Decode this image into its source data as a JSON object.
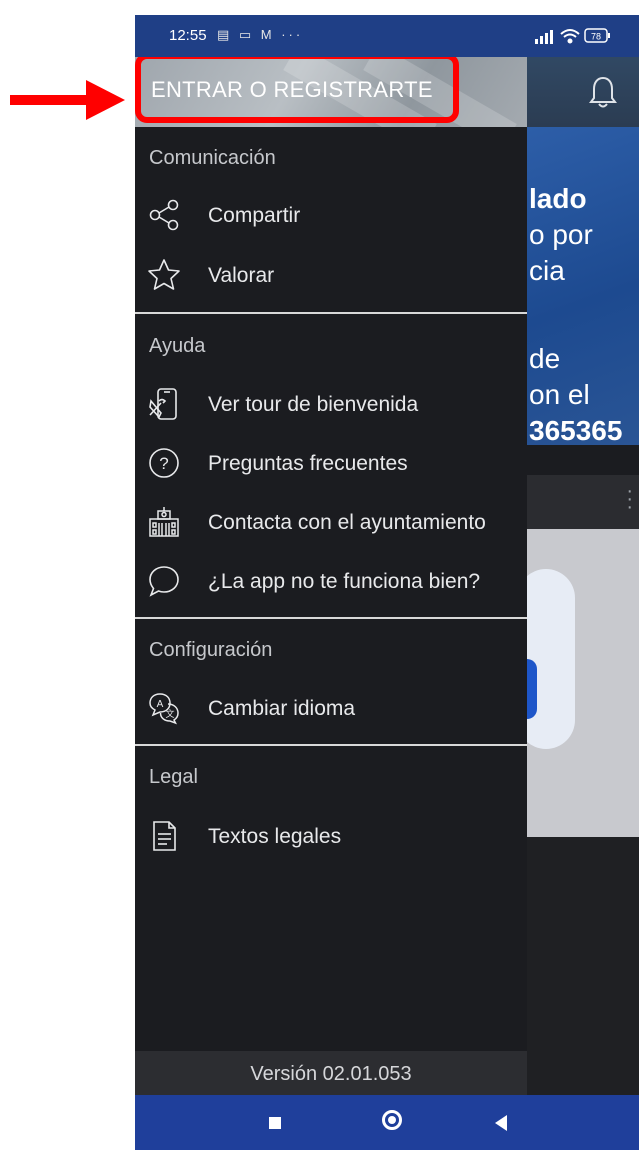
{
  "status_bar": {
    "time": "12:55",
    "notification_icons": "▤ ▭ M ···",
    "battery": "78"
  },
  "drawer": {
    "login_label": "ENTRAR O REGISTRARTE",
    "sections": [
      {
        "title": "Comunicación",
        "items": [
          {
            "label": "Compartir",
            "icon": "share-icon"
          },
          {
            "label": "Valorar",
            "icon": "star-icon"
          }
        ]
      },
      {
        "title": "Ayuda",
        "items": [
          {
            "label": "Ver tour de bienvenida",
            "icon": "phone-tools-icon"
          },
          {
            "label": "Preguntas frecuentes",
            "icon": "question-icon"
          },
          {
            "label": "Contacta con el ayuntamiento",
            "icon": "building-icon"
          },
          {
            "label": "¿La app no te funciona bien?",
            "icon": "chat-bubble-icon"
          }
        ]
      },
      {
        "title": "Configuración",
        "items": [
          {
            "label": "Cambiar idioma",
            "icon": "translate-icon"
          }
        ]
      },
      {
        "title": "Legal",
        "items": [
          {
            "label": "Textos legales",
            "icon": "document-icon"
          }
        ]
      }
    ],
    "version": "Versión 02.01.053"
  },
  "background": {
    "banner_lines": [
      "lado",
      "o por",
      "cia",
      "de",
      "on el",
      "365365"
    ]
  },
  "colors": {
    "drawer_bg": "#1b1c20",
    "highlight": "#ff0000",
    "nav_bar": "#1f3f9b",
    "status_bar": "#1f3f86"
  }
}
